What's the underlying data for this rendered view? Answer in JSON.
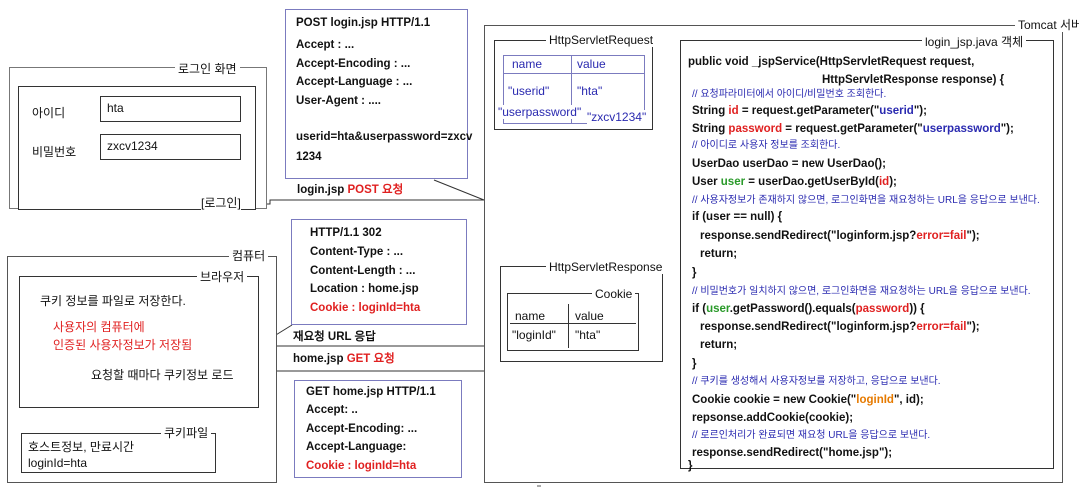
{
  "login_screen": {
    "title": "로그인 화면",
    "id_label": "아이디",
    "id_value": "hta",
    "pw_label": "비밀번호",
    "pw_value": "zxcv1234",
    "login_button": "[로그인]"
  },
  "post_request": {
    "lines": [
      "POST  login.jsp   HTTP/1.1",
      "Accept : ...",
      "Accept-Encoding : ...",
      "Accept-Language : ...",
      "User-Agent : ....",
      "",
      "userid=hta&userpassword=zxcv",
      "1234"
    ],
    "arrow_label_prefix": "login.jsp ",
    "arrow_label_emphasis": "POST 요청"
  },
  "response_302": {
    "lines": [
      "HTTP/1.1   302",
      "Content-Type : ...",
      "Content-Length : ...",
      "Location : home.jsp"
    ],
    "cookie_line": "Cookie : loginId=hta",
    "arrow_label": "재요청 URL 응답"
  },
  "get_request": {
    "arrow_label_prefix": "home.jsp ",
    "arrow_label_emphasis": "GET 요청",
    "lines": [
      "GET home.jsp HTTP/1.1",
      "Accept: ..",
      "Accept-Encoding: ...",
      "Accept-Language:"
    ],
    "cookie_line": "Cookie : loginId=hta"
  },
  "computer": {
    "title": "컴퓨터",
    "browser_title": "브라우저",
    "save_text": "쿠키 정보를 파일로 저장한다.",
    "note_line1": "사용자의 컴퓨터에",
    "note_line2": "인증된 사용자정보가 저장됨",
    "load_text": "요청할  때마다 쿠키정보 로드",
    "cookie_file_title": "쿠키파일",
    "cookie_file_line1": "호스트정보, 만료시간",
    "cookie_file_line2": "loginId=hta"
  },
  "server": {
    "title": "Tomcat 서버",
    "request_object": {
      "title": "HttpServletRequest",
      "headers": [
        "name",
        "value"
      ],
      "rows": [
        [
          "\"userid\"",
          "\"hta\""
        ],
        [
          "\"userpassword\"",
          "\"zxcv1234\""
        ]
      ]
    },
    "response_object": {
      "title": "HttpServletResponse",
      "cookie_title": "Cookie",
      "headers": [
        "name",
        "value"
      ],
      "rows": [
        [
          "\"loginId\"",
          "\"hta\""
        ]
      ]
    },
    "jsp": {
      "title": "login_jsp.java 객체",
      "code": [
        {
          "t": "public void _jspService(HttpServletRequest request,"
        },
        {
          "t": "HttpServletResponse response) {"
        },
        {
          "c": "// 요청파라미터에서 아이디/비밀번호 조회한다."
        },
        {
          "t1": "String ",
          "r": "id",
          "t2": " = request.getParameter(\"",
          "b": "userid",
          "t3": "\");"
        },
        {
          "t1": "String ",
          "r": "password",
          "t2": " = request.getParameter(\"",
          "b": "userpassword",
          "t3": "\");"
        },
        {
          "c": "// 아이디로 사용자 정보를 조회한다."
        },
        {
          "t": "UserDao userDao = new UserDao();"
        },
        {
          "t1": "User ",
          "g": "user",
          "t2": " = userDao.getUserById(",
          "r": "id",
          "t3": ");"
        },
        {
          "c": "// 사용자정보가 존재하지 않으면, 로그인화면을 재요청하는 URL을 응답으로 보낸다."
        },
        {
          "t": "if (user == null) {"
        },
        {
          "t1": "response.sendRedirect(\"loginform.jsp?",
          "r": "error=fail",
          "t2": "\");"
        },
        {
          "t": "return;"
        },
        {
          "t": "}"
        },
        {
          "c": "// 비밀번호가 일치하지 않으면, 로그인화면을 재요청하는 URL을 응답으로 보낸다."
        },
        {
          "t1": "if (",
          "g": "user",
          "t2": ".getPassword().equals(",
          "r": "password",
          "t3": ")) {"
        },
        {
          "t1": "response.sendRedirect(\"loginform.jsp?",
          "r": "error=fail",
          "t2": "\");"
        },
        {
          "t": "return;"
        },
        {
          "t": "}"
        },
        {
          "c": "// 쿠키를 생성해서 사용자정보를 저장하고, 응답으로 보낸다."
        },
        {
          "t1": "Cookie cookie = new Cookie(\"",
          "o": "loginId",
          "t2": "\", id);"
        },
        {
          "t": "repsonse.addCookie(cookie);"
        },
        {
          "c": "// 로르인처리가 완료되면 재요청 URL을 응답으로 보낸다."
        },
        {
          "t": "response.sendRedirect(\"home.jsp\");"
        },
        {
          "t": "}"
        }
      ]
    }
  },
  "colors": {
    "red": "#e02020",
    "blue": "#2a2ab0",
    "green": "#2a9a2a",
    "orange": "#e67a00",
    "border_blue": "#7b7bbf"
  }
}
